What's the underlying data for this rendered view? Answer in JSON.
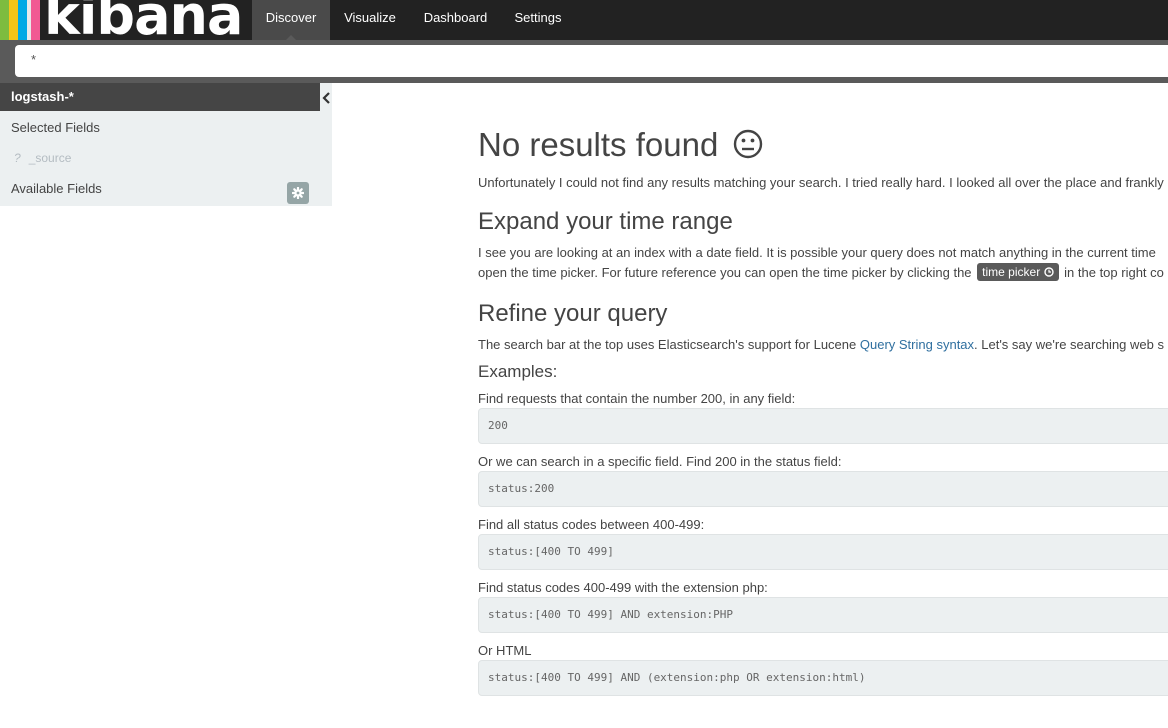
{
  "app": {
    "logo_text": "kibana",
    "logo_colors": [
      "#7dbc3f",
      "#f6c519",
      "#f15a93",
      "#00a9e5",
      "#fbc02d",
      "#e91e63"
    ]
  },
  "nav": {
    "tabs": [
      {
        "label": "Discover",
        "active": true
      },
      {
        "label": "Visualize",
        "active": false
      },
      {
        "label": "Dashboard",
        "active": false
      },
      {
        "label": "Settings",
        "active": false
      }
    ]
  },
  "search": {
    "value": "*"
  },
  "sidebar": {
    "index_pattern": "logstash-*",
    "selected_fields_label": "Selected Fields",
    "source_field": {
      "type_icon": "?",
      "name": "_source"
    },
    "available_fields_label": "Available Fields"
  },
  "main": {
    "title": "No results found",
    "title_emoji": "😐",
    "intro": "Unfortunately I could not find any results matching your search. I tried really hard. I looked all over the place and frankly",
    "time_section": {
      "heading": "Expand your time range",
      "line1": "I see you are looking at an index with a date field. It is possible your query does not match anything in the current time",
      "line2_before": "open the time picker. For future reference you can open the time picker by clicking the",
      "time_picker_label": "time picker",
      "line2_after": "in the top right co"
    },
    "query_section": {
      "heading": "Refine your query",
      "text_before": "The search bar at the top uses Elasticsearch's support for Lucene",
      "link_text": "Query String syntax",
      "text_after": ". Let's say we're searching web s",
      "examples_label": "Examples:",
      "examples": [
        {
          "description": "Find requests that contain the number 200, in any field:",
          "query": "200"
        },
        {
          "description": "Or we can search in a specific field. Find 200 in the status field:",
          "query": "status:200"
        },
        {
          "description": "Find all status codes between 400-499:",
          "query": "status:[400 TO 499]"
        },
        {
          "description": "Find status codes 400-499 with the extension php:",
          "query": "status:[400 TO 499] AND extension:PHP"
        },
        {
          "description": "Or HTML",
          "query": "status:[400 TO 499] AND (extension:php OR extension:html)"
        }
      ]
    }
  }
}
